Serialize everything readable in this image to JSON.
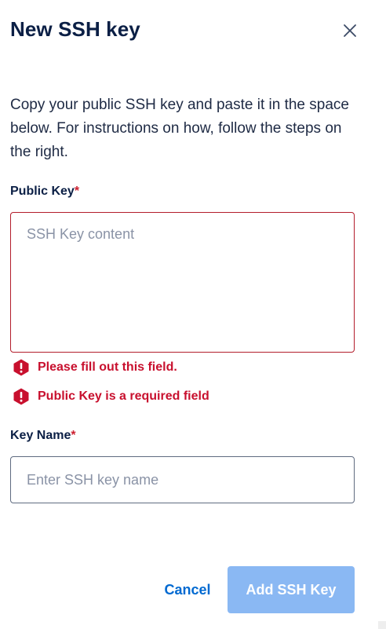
{
  "dialog": {
    "title": "New SSH key",
    "close_icon": "close-icon",
    "description": "Copy your public SSH key and paste it in the space below. For instructions on how, follow the steps on the right."
  },
  "form": {
    "public_key": {
      "label": "Public Key",
      "required_marker": "*",
      "placeholder": "SSH Key content",
      "value": "",
      "errors": [
        {
          "icon": "error-octagon-icon",
          "text": "Please fill out this field."
        },
        {
          "icon": "error-octagon-icon",
          "text": "Public Key is a required field"
        }
      ]
    },
    "key_name": {
      "label": "Key Name",
      "required_marker": "*",
      "placeholder": "Enter SSH key name",
      "value": ""
    }
  },
  "actions": {
    "cancel_label": "Cancel",
    "submit_label": "Add SSH Key",
    "submit_disabled": true
  },
  "colors": {
    "title": "#0b1f45",
    "error": "#c8102e",
    "error_border": "#b31d2b",
    "link": "#0069d1",
    "primary_disabled": "#8ab8f3"
  }
}
